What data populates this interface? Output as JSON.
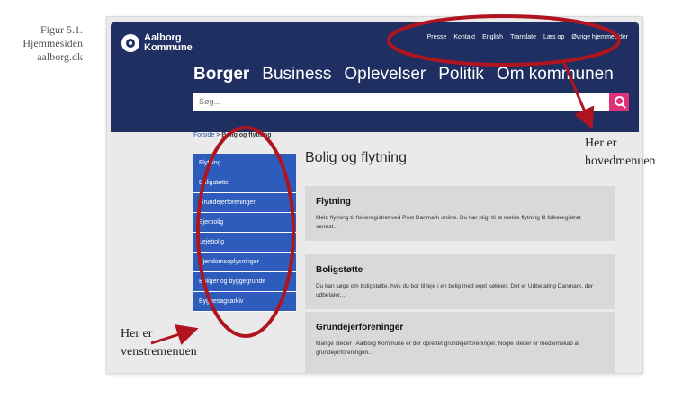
{
  "figure_caption": {
    "line1": "Figur 5.1.",
    "line2": "Hjemmesiden",
    "line3": "aalborg.dk"
  },
  "header": {
    "logo": {
      "line1": "Aalborg",
      "line2": "Kommune",
      "icon": "seal-icon"
    },
    "top_links": [
      "Presse",
      "Kontakt",
      "English",
      "Translate",
      "Læs op",
      "Øvrige hjemmesider"
    ],
    "main_nav": [
      "Borger",
      "Business",
      "Oplevelser",
      "Politik",
      "Om kommunen"
    ],
    "search": {
      "placeholder": "Søg...",
      "icon": "search-icon"
    }
  },
  "breadcrumb": {
    "home": "Forside",
    "separator": ">",
    "current": "Bolig og flytning"
  },
  "left_menu": [
    "Flytning",
    "Boligstøtte",
    "Grundejerforeninger",
    "Ejerbolig",
    "Lejebolig",
    "Ejendomsoplysninger",
    "Boliger og byggegrunde",
    "Byggesagsarkiv"
  ],
  "page_title": "Bolig og flytning",
  "cards": [
    {
      "title": "Flytning",
      "text": "Meld flytning til folkeregistret ved Post Danmark online. Du har pligt til at melde flytning til folkeregistret senest..."
    },
    {
      "title": "Boligstøtte",
      "text": "Du kan søge om boligstøtte, hvis du bor til leje i en bolig med eget køkken. Det er Udbetaling Danmark, der udbetaler..."
    },
    {
      "title": "Grundejerforeninger",
      "text": "Mange steder i Aalborg Kommune er der oprettet grundejerforeninger. Nogle steder er medlemskab af grundejerforeningen..."
    }
  ],
  "annotations": {
    "top": {
      "line1": "Her er",
      "line2": "hovedmenuen"
    },
    "left": {
      "line1": "Her er",
      "line2": "venstremenuen"
    }
  },
  "colors": {
    "header_bg": "#1f2f62",
    "menu_bg": "#2e5cbc",
    "search_btn": "#e0307a",
    "annotation": "#b0141e",
    "card_bg": "#d9d9d9"
  }
}
